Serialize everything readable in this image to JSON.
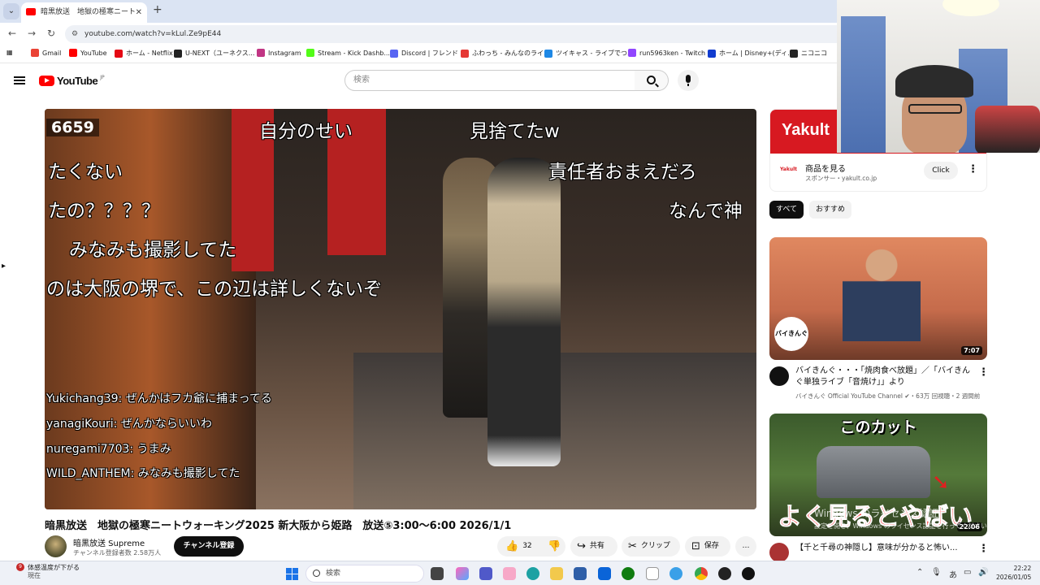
{
  "browser": {
    "tab_title": "暗黒放送　地獄の極寒ニート",
    "tab_close": "✕",
    "new_tab": "+",
    "url": "youtube.com/watch?v=kLul.Ze9pE44",
    "bookmarks": [
      {
        "label": "Gmail",
        "color": "#ea4335"
      },
      {
        "label": "YouTube",
        "color": "#ff0000"
      },
      {
        "label": "ホーム - Netflix",
        "color": "#e50914"
      },
      {
        "label": "U-NEXT（ユーネクス...",
        "color": "#222222"
      },
      {
        "label": "Instagram",
        "color": "#c13584"
      },
      {
        "label": "Stream - Kick Dashb...",
        "color": "#53fc18"
      },
      {
        "label": "Discord | フレンド",
        "color": "#5865f2"
      },
      {
        "label": "ふわっち - みんなのライ...",
        "color": "#e53935"
      },
      {
        "label": "ツイキャス - ライブでつ...",
        "color": "#1e88e5"
      },
      {
        "label": "run5963ken - Twitch",
        "color": "#9146ff"
      },
      {
        "label": "ホーム | Disney+(ディ...",
        "color": "#113ccf"
      },
      {
        "label": "ニコニコ",
        "color": "#252525"
      }
    ]
  },
  "youtube": {
    "logo_text": "YouTube",
    "region": "JP",
    "search_placeholder": "検索"
  },
  "video": {
    "counter": "6659",
    "danmaku": [
      "自分のせい",
      "見捨てたw",
      "たくない",
      "責任者おまえだろ",
      "たの？？？？",
      "なんで神",
      "みなみも撮影してた",
      "のは大阪の堺で、この辺は詳しくないぞ"
    ],
    "chat": [
      "Yukichang39: ぜんかはフカ爺に捕まってる",
      "yanagiKouri: ぜんかならいいわ",
      "nuregami7703: うまみ",
      "WILD_ANTHEM: みなみも撮影してた"
    ],
    "title": "暗黒放送　地獄の極寒ニートウォーキング2025 新大阪から姫路　放送⑤3:00〜6:00 2026/1/1",
    "channel_name": "暗黒放送 Supreme",
    "channel_subs": "チャンネル登録者数 2.58万人",
    "subscribe_label": "チャンネル登録",
    "like_count": "32",
    "share_label": "共有",
    "clip_label": "クリップ",
    "save_label": "保存",
    "more_label": "…"
  },
  "sidebar": {
    "ad": {
      "brand": "Yakult",
      "title": "商品を見る",
      "sponsor": "スポンサー・yakult.co.jp",
      "click_label": "Click"
    },
    "chips": [
      "すべて",
      "おすすめ"
    ],
    "videos": [
      {
        "title": "バイきんぐ・・・「焼肉食べ放題」／「バイきんぐ単独ライブ「音焼け」」より",
        "channel": "バイきんぐ Official YouTube Channel",
        "meta": "・63万 回視聴・2 週間前",
        "duration": "7:07",
        "badge": "バイきんぐ"
      },
      {
        "title": "【千と千尋の神隠し】意味が分かると怖い...",
        "channel": "",
        "meta": "",
        "duration": "22:06",
        "top_text": "このカット",
        "bottom_text": "よく見るとやばい"
      }
    ]
  },
  "watermark": {
    "line1": "Windows のライセンス認証",
    "line2": "設定を開き、Windows のライセンス認証を行ってください。"
  },
  "taskbar": {
    "weather_badge": "9",
    "weather_title": "体感温度が下がる",
    "weather_sub": "現在",
    "search_label": "検索",
    "ime": "あ",
    "time": "22:22",
    "date": "2026/01/05"
  }
}
